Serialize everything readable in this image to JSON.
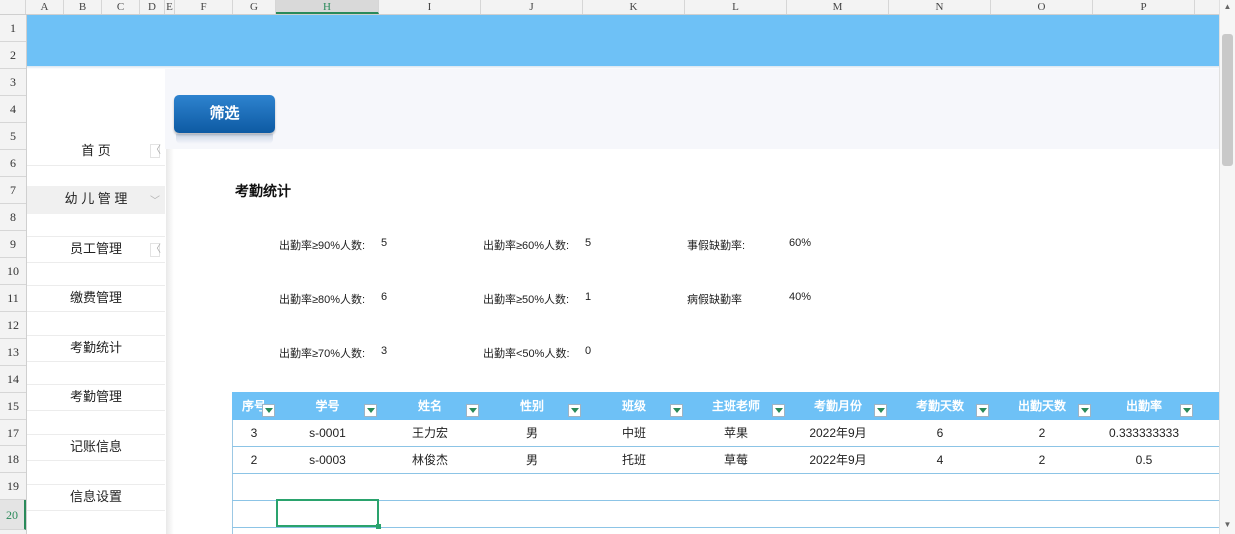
{
  "sheet": {
    "columns": [
      "A",
      "B",
      "C",
      "D",
      "E",
      "F",
      "G",
      "H",
      "I",
      "J",
      "K",
      "L",
      "M",
      "N",
      "O",
      "P"
    ],
    "selected_column": "H",
    "rows": [
      "1",
      "2",
      "3",
      "4",
      "5",
      "6",
      "7",
      "8",
      "9",
      "10",
      "11",
      "12",
      "13",
      "14",
      "15",
      "17",
      "18",
      "19",
      "20"
    ],
    "selected_row": "20"
  },
  "filter_button": {
    "label": "筛选"
  },
  "sidebar": {
    "items": [
      {
        "label": "首 页",
        "chevron": "〈"
      },
      {
        "label": "幼 儿 管 理",
        "chevron": "﹀"
      },
      {
        "label": "员工管理",
        "chevron": "〈"
      },
      {
        "label": "缴费管理"
      },
      {
        "label": "考勤统计"
      },
      {
        "label": "考勤管理"
      },
      {
        "label": "记账信息"
      },
      {
        "label": "信息设置"
      }
    ]
  },
  "stats": {
    "title": "考勤统计",
    "items": [
      {
        "label": "出勤率≥90%人数:",
        "value": "5"
      },
      {
        "label": "出勤率≥80%人数:",
        "value": "6"
      },
      {
        "label": "出勤率≥70%人数:",
        "value": "3"
      },
      {
        "label": "出勤率≥60%人数:",
        "value": "5"
      },
      {
        "label": "出勤率≥50%人数:",
        "value": "1"
      },
      {
        "label": "出勤率<50%人数:",
        "value": "0"
      },
      {
        "label": "事假缺勤率:",
        "value": "60%"
      },
      {
        "label": "病假缺勤率",
        "value": "40%"
      }
    ]
  },
  "table": {
    "headers": [
      "序号",
      "学号",
      "姓名",
      "性别",
      "班级",
      "主班老师",
      "考勤月份",
      "考勤天数",
      "出勤天数",
      "出勤率"
    ],
    "rows": [
      [
        "3",
        "s-0001",
        "王力宏",
        "男",
        "中班",
        "苹果",
        "2022年9月",
        "6",
        "2",
        "0.333333333"
      ],
      [
        "2",
        "s-0003",
        "林俊杰",
        "男",
        "托班",
        "草莓",
        "2022年9月",
        "4",
        "2",
        "0.5"
      ]
    ]
  },
  "colors": {
    "banner": "#6ec1f6",
    "header": "#6ec1f6",
    "button": "#0d5aa3",
    "selection": "#2aa36d"
  }
}
